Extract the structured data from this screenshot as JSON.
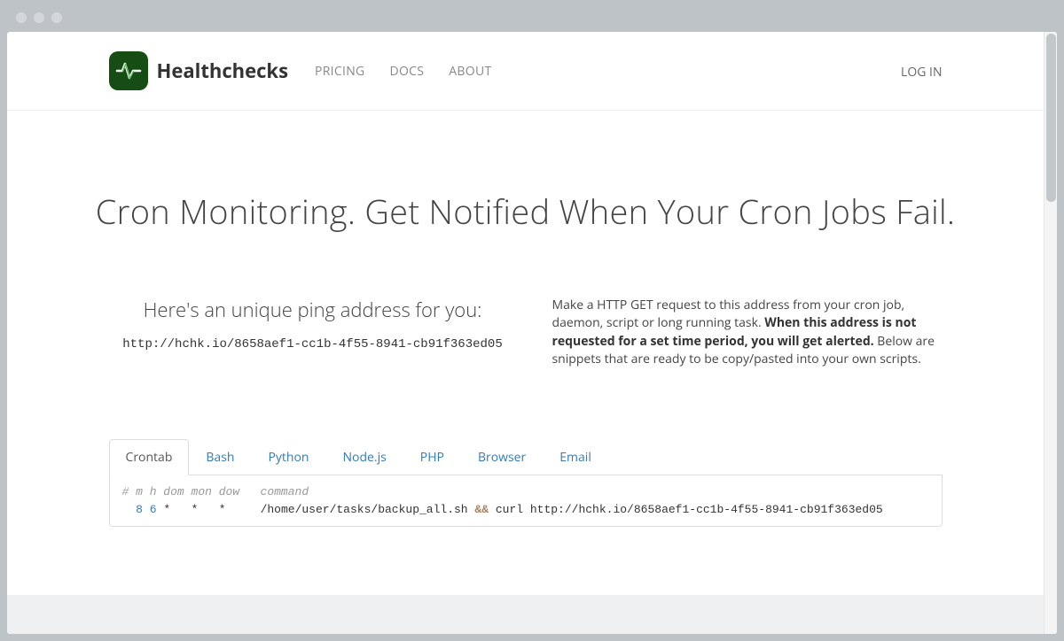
{
  "brand": "Healthchecks",
  "nav": {
    "pricing": "PRICING",
    "docs": "DOCS",
    "about": "ABOUT",
    "login": "LOG IN"
  },
  "hero": {
    "headline": "Cron Monitoring. Get Notified When Your Cron Jobs Fail."
  },
  "ping": {
    "heading": "Here's an unique ping address for you:",
    "url": "http://hchk.io/8658aef1-cc1b-4f55-8941-cb91f363ed05"
  },
  "description": {
    "part1": "Make a HTTP GET request to this address from your cron job, daemon, script or long running task. ",
    "bold": "When this address is not requested for a set time period, you will get alerted.",
    "part2": " Below are snippets that are ready to be copy/pasted into your own scripts."
  },
  "tabs": {
    "crontab": "Crontab",
    "bash": "Bash",
    "python": "Python",
    "nodejs": "Node.js",
    "php": "PHP",
    "browser": "Browser",
    "email": "Email"
  },
  "code": {
    "comment": "# m h dom mon dow   command",
    "minute": "8",
    "hour": "6",
    "rest_schedule": " *   *   *",
    "command_prefix": "     /home/user/tasks/backup_all.sh ",
    "operator": "&&",
    "command_suffix": " curl http://hchk.io/8658aef1-cc1b-4f55-8941-cb91f363ed05"
  }
}
